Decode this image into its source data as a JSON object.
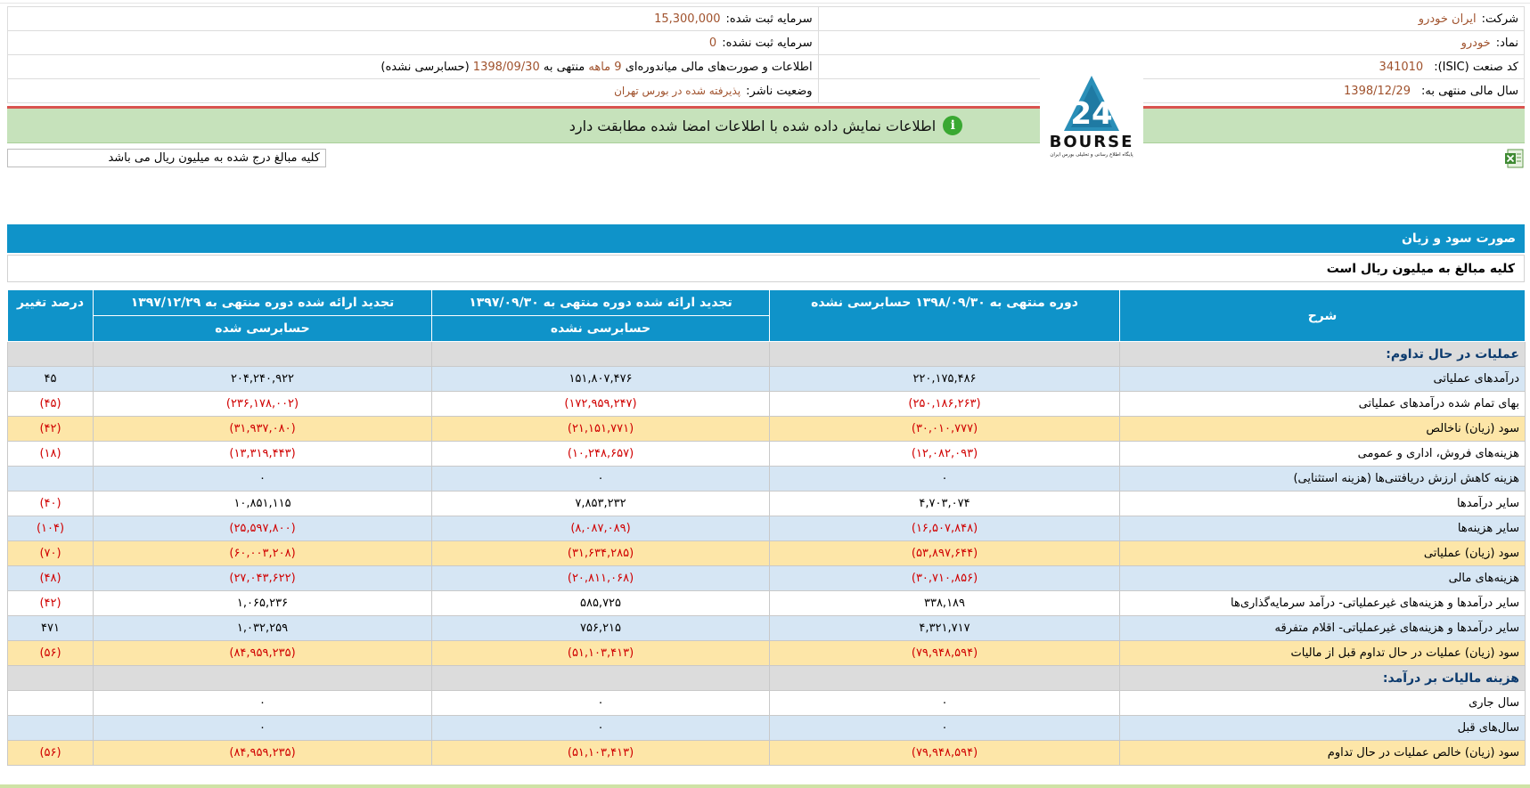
{
  "header": {
    "company_label": "شرکت:",
    "company_value": "ایران خودرو",
    "symbol_label": "نماد:",
    "symbol_value": "خودرو",
    "isic_label": "کد صنعت (ISIC):",
    "isic_value": "341010",
    "fiscal_label": "سال مالی منتهی به:",
    "fiscal_value": "1398/12/29",
    "registered_capital_label": "سرمایه ثبت شده:",
    "registered_capital_value": "15,300,000",
    "unregistered_capital_label": "سرمایه ثبت نشده:",
    "unregistered_capital_value": "0",
    "report_pre": "اطلاعات و صورت‌های مالی میاندوره‌ای",
    "report_months": "9 ماهه",
    "report_mid": "منتهی به",
    "report_date": "1398/09/30",
    "report_post": "(حسابرسی نشده)",
    "publisher_label": "وضعیت ناشر:",
    "publisher_value": "پذیرفته شده در بورس تهران"
  },
  "notice": {
    "icon": "info-icon",
    "text": "اطلاعات نمایش داده شده با اطلاعات امضا شده مطابقت دارد"
  },
  "logo": {
    "brand": "BOURSE",
    "numeral": "24",
    "subtitle": "پایگاه اطلاع رسانی و تحلیلی بورس ایران"
  },
  "unit_note": "کلیه مبالغ درج شده به میلیون ریال می باشد",
  "section": {
    "title": "صورت سود و زیان",
    "unit": "کلیه مبالغ به میلیون ریال است"
  },
  "table": {
    "headers": {
      "desc": "شرح",
      "col1": "دوره منتهی به ۱۳۹۸/۰۹/۳۰ حسابرسی نشده",
      "col2": "تجدید ارائه شده دوره منتهی به ۱۳۹۷/۰۹/۳۰",
      "col2_sub": "حسابرسی نشده",
      "col3": "تجدید ارائه شده دوره منتهی به ۱۳۹۷/۱۲/۲۹",
      "col3_sub": "حسابرسی شده",
      "pct": "درصد تغییر"
    },
    "rows": [
      {
        "type": "gray",
        "desc": "عملیات در حال تداوم:",
        "c1": "",
        "c2": "",
        "c3": "",
        "pct": ""
      },
      {
        "type": "blue",
        "desc": "درآمدهای عملیاتی",
        "c1": "۲۲۰,۱۷۵,۴۸۶",
        "c2": "۱۵۱,۸۰۷,۴۷۶",
        "c3": "۲۰۴,۲۴۰,۹۲۲",
        "pct": "۴۵",
        "neg": false
      },
      {
        "type": "white",
        "desc": "بهای تمام شده درآمدهای عملیاتی",
        "c1": "(۲۵۰,۱۸۶,۲۶۳)",
        "c2": "(۱۷۲,۹۵۹,۲۴۷)",
        "c3": "(۲۳۶,۱۷۸,۰۰۲)",
        "pct": "(۴۵)",
        "neg": true
      },
      {
        "type": "yellow",
        "desc": "سود (زیان) ناخالص",
        "c1": "(۳۰,۰۱۰,۷۷۷)",
        "c2": "(۲۱,۱۵۱,۷۷۱)",
        "c3": "(۳۱,۹۳۷,۰۸۰)",
        "pct": "(۴۲)",
        "neg": true
      },
      {
        "type": "white",
        "desc": "هزینه‌های فروش، اداری و عمومی",
        "c1": "(۱۲,۰۸۲,۰۹۳)",
        "c2": "(۱۰,۲۴۸,۶۵۷)",
        "c3": "(۱۳,۳۱۹,۴۴۳)",
        "pct": "(۱۸)",
        "neg": true
      },
      {
        "type": "blue",
        "desc": "هزینه کاهش ارزش دریافتنی‌ها (هزینه استثنایی)",
        "c1": "۰",
        "c2": "۰",
        "c3": "۰",
        "pct": "",
        "neg": false
      },
      {
        "type": "white",
        "desc": "سایر درآمدها",
        "c1": "۴,۷۰۳,۰۷۴",
        "c2": "۷,۸۵۳,۲۳۲",
        "c3": "۱۰,۸۵۱,۱۱۵",
        "pct": "(۴۰)",
        "neg": false,
        "pctneg": true
      },
      {
        "type": "blue",
        "desc": "سایر هزینه‌ها",
        "c1": "(۱۶,۵۰۷,۸۴۸)",
        "c2": "(۸,۰۸۷,۰۸۹)",
        "c3": "(۲۵,۵۹۷,۸۰۰)",
        "pct": "(۱۰۴)",
        "neg": true
      },
      {
        "type": "yellow",
        "desc": "سود (زیان) عملیاتی",
        "c1": "(۵۳,۸۹۷,۶۴۴)",
        "c2": "(۳۱,۶۳۴,۲۸۵)",
        "c3": "(۶۰,۰۰۳,۲۰۸)",
        "pct": "(۷۰)",
        "neg": true
      },
      {
        "type": "blue",
        "desc": "هزینه‌های مالی",
        "c1": "(۳۰,۷۱۰,۸۵۶)",
        "c2": "(۲۰,۸۱۱,۰۶۸)",
        "c3": "(۲۷,۰۴۳,۶۲۲)",
        "pct": "(۴۸)",
        "neg": true
      },
      {
        "type": "white",
        "desc": "سایر درآمدها و هزینه‌های غیرعملیاتی- درآمد سرمایه‌گذاری‌ها",
        "c1": "۳۳۸,۱۸۹",
        "c2": "۵۸۵,۷۲۵",
        "c3": "۱,۰۶۵,۲۳۶",
        "pct": "(۴۲)",
        "neg": false,
        "pctneg": true
      },
      {
        "type": "blue",
        "desc": "سایر درآمدها و هزینه‌های غیرعملیاتی- اقلام متفرقه",
        "c1": "۴,۳۲۱,۷۱۷",
        "c2": "۷۵۶,۲۱۵",
        "c3": "۱,۰۳۲,۲۵۹",
        "pct": "۴۷۱",
        "neg": false
      },
      {
        "type": "yellow",
        "desc": "سود (زیان) عملیات در حال تداوم قبل از مالیات",
        "c1": "(۷۹,۹۴۸,۵۹۴)",
        "c2": "(۵۱,۱۰۳,۴۱۳)",
        "c3": "(۸۴,۹۵۹,۲۳۵)",
        "pct": "(۵۶)",
        "neg": true
      },
      {
        "type": "gray",
        "desc": "هزینه مالیات بر درآمد:",
        "c1": "",
        "c2": "",
        "c3": "",
        "pct": ""
      },
      {
        "type": "white",
        "desc": "سال جاری",
        "c1": "۰",
        "c2": "۰",
        "c3": "۰",
        "pct": "",
        "neg": false
      },
      {
        "type": "blue",
        "desc": "سال‌های قبل",
        "c1": "۰",
        "c2": "۰",
        "c3": "۰",
        "pct": "",
        "neg": false
      },
      {
        "type": "yellow",
        "desc": "سود (زیان) خالص عملیات در حال تداوم",
        "c1": "(۷۹,۹۴۸,۵۹۴)",
        "c2": "(۵۱,۱۰۳,۴۱۳)",
        "c3": "(۸۴,۹۵۹,۲۳۵)",
        "pct": "(۵۶)",
        "neg": true
      }
    ]
  }
}
